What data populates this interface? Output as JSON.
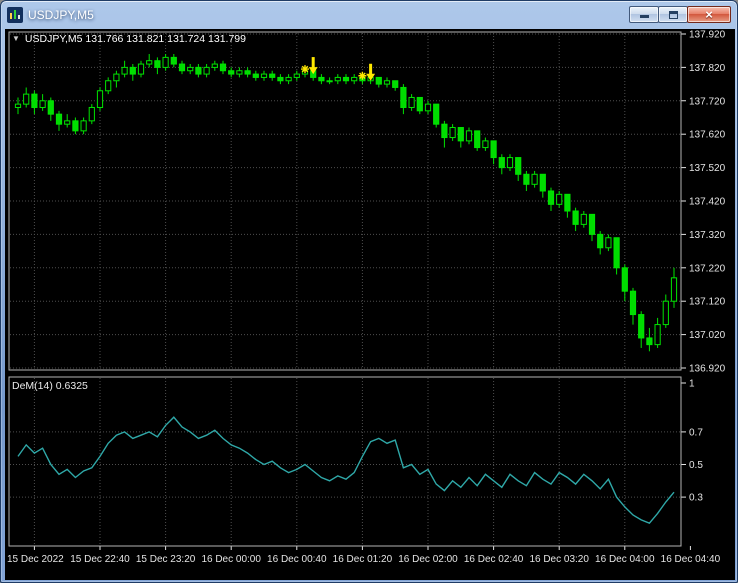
{
  "window": {
    "title": "USDJPY,M5"
  },
  "icons": {
    "collapse_arrow": "▼",
    "close_glyph": "×"
  },
  "chart": {
    "ohlc_text": "USDJPY,M5 131.766 131.821 131.724 131.799"
  },
  "chart_data": {
    "type": "candlestick",
    "symbol": "USDJPY",
    "timeframe": "M5",
    "main": {
      "price_max": 137.92,
      "price_min": 136.92,
      "price_axis": [
        "137.920",
        "137.820",
        "137.720",
        "137.620",
        "137.520",
        "137.420",
        "137.320",
        "137.220",
        "137.120",
        "137.020",
        "136.920"
      ],
      "candles": [
        [
          137.7,
          137.73,
          137.68,
          137.71
        ],
        [
          137.71,
          137.76,
          137.7,
          137.74
        ],
        [
          137.74,
          137.75,
          137.68,
          137.7
        ],
        [
          137.7,
          137.74,
          137.69,
          137.72
        ],
        [
          137.72,
          137.73,
          137.66,
          137.68
        ],
        [
          137.68,
          137.69,
          137.63,
          137.65
        ],
        [
          137.65,
          137.68,
          137.64,
          137.66
        ],
        [
          137.66,
          137.67,
          137.62,
          137.63
        ],
        [
          137.63,
          137.67,
          137.62,
          137.66
        ],
        [
          137.66,
          137.71,
          137.65,
          137.7
        ],
        [
          137.7,
          137.76,
          137.69,
          137.75
        ],
        [
          137.75,
          137.79,
          137.74,
          137.78
        ],
        [
          137.78,
          137.81,
          137.76,
          137.8
        ],
        [
          137.8,
          137.84,
          137.79,
          137.82
        ],
        [
          137.82,
          137.83,
          137.78,
          137.8
        ],
        [
          137.8,
          137.84,
          137.79,
          137.83
        ],
        [
          137.83,
          137.86,
          137.82,
          137.84
        ],
        [
          137.84,
          137.85,
          137.8,
          137.82
        ],
        [
          137.82,
          137.86,
          137.81,
          137.85
        ],
        [
          137.85,
          137.86,
          137.82,
          137.83
        ],
        [
          137.83,
          137.84,
          137.8,
          137.81
        ],
        [
          137.81,
          137.83,
          137.8,
          137.82
        ],
        [
          137.82,
          137.83,
          137.79,
          137.8
        ],
        [
          137.8,
          137.83,
          137.79,
          137.82
        ],
        [
          137.82,
          137.84,
          137.81,
          137.83
        ],
        [
          137.83,
          137.84,
          137.8,
          137.81
        ],
        [
          137.81,
          137.82,
          137.79,
          137.8
        ],
        [
          137.8,
          137.82,
          137.79,
          137.81
        ],
        [
          137.81,
          137.82,
          137.79,
          137.8
        ],
        [
          137.8,
          137.81,
          137.78,
          137.79
        ],
        [
          137.79,
          137.81,
          137.78,
          137.8
        ],
        [
          137.8,
          137.81,
          137.78,
          137.79
        ],
        [
          137.79,
          137.8,
          137.77,
          137.78
        ],
        [
          137.78,
          137.8,
          137.77,
          137.79
        ],
        [
          137.79,
          137.81,
          137.78,
          137.8
        ],
        [
          137.8,
          137.82,
          137.79,
          137.81
        ],
        [
          137.81,
          137.82,
          137.78,
          137.79
        ],
        [
          137.79,
          137.8,
          137.77,
          137.78
        ],
        [
          137.78,
          137.79,
          137.77,
          137.78
        ],
        [
          137.78,
          137.8,
          137.77,
          137.79
        ],
        [
          137.79,
          137.8,
          137.77,
          137.78
        ],
        [
          137.78,
          137.8,
          137.77,
          137.79
        ],
        [
          137.79,
          137.8,
          137.77,
          137.78
        ],
        [
          137.78,
          137.8,
          137.77,
          137.79
        ],
        [
          137.79,
          137.79,
          137.76,
          137.77
        ],
        [
          137.77,
          137.79,
          137.76,
          137.78
        ],
        [
          137.78,
          137.78,
          137.75,
          137.76
        ],
        [
          137.76,
          137.77,
          137.68,
          137.7
        ],
        [
          137.7,
          137.74,
          137.69,
          137.73
        ],
        [
          137.73,
          137.73,
          137.68,
          137.69
        ],
        [
          137.69,
          137.72,
          137.68,
          137.71
        ],
        [
          137.71,
          137.71,
          137.64,
          137.65
        ],
        [
          137.65,
          137.66,
          137.58,
          137.61
        ],
        [
          137.61,
          137.65,
          137.6,
          137.64
        ],
        [
          137.64,
          137.64,
          137.58,
          137.6
        ],
        [
          137.6,
          137.64,
          137.59,
          137.63
        ],
        [
          137.63,
          137.63,
          137.57,
          137.58
        ],
        [
          137.58,
          137.61,
          137.57,
          137.6
        ],
        [
          137.6,
          137.6,
          137.53,
          137.55
        ],
        [
          137.55,
          137.56,
          137.5,
          137.52
        ],
        [
          137.52,
          137.56,
          137.51,
          137.55
        ],
        [
          137.55,
          137.55,
          137.48,
          137.5
        ],
        [
          137.5,
          137.51,
          137.45,
          137.47
        ],
        [
          137.47,
          137.51,
          137.46,
          137.5
        ],
        [
          137.5,
          137.5,
          137.43,
          137.45
        ],
        [
          137.45,
          137.46,
          137.39,
          137.41
        ],
        [
          137.41,
          137.45,
          137.4,
          137.44
        ],
        [
          137.44,
          137.44,
          137.37,
          137.39
        ],
        [
          137.39,
          137.4,
          137.33,
          137.35
        ],
        [
          137.35,
          137.39,
          137.34,
          137.38
        ],
        [
          137.38,
          137.38,
          137.3,
          137.32
        ],
        [
          137.32,
          137.33,
          137.26,
          137.28
        ],
        [
          137.28,
          137.32,
          137.27,
          137.31
        ],
        [
          137.31,
          137.31,
          137.2,
          137.22
        ],
        [
          137.22,
          137.23,
          137.12,
          137.15
        ],
        [
          137.15,
          137.16,
          137.05,
          137.08
        ],
        [
          137.08,
          137.09,
          136.98,
          137.01
        ],
        [
          137.01,
          137.04,
          136.97,
          136.99
        ],
        [
          136.99,
          137.07,
          136.98,
          137.05
        ],
        [
          137.05,
          137.14,
          137.04,
          137.12
        ],
        [
          137.12,
          137.22,
          137.1,
          137.19
        ]
      ],
      "markers": [
        {
          "type": "asterisk",
          "candle": 35,
          "price": 137.815
        },
        {
          "type": "arrow-down",
          "candle": 36,
          "price": 137.8
        },
        {
          "type": "asterisk",
          "candle": 42,
          "price": 137.795
        },
        {
          "type": "arrow-down",
          "candle": 43,
          "price": 137.78
        }
      ]
    },
    "indicator": {
      "name": "DeMarker",
      "label": "DeM(14) 0.6325",
      "range": [
        0,
        1
      ],
      "axis": [
        {
          "label": "1",
          "value": 1
        },
        {
          "label": "0.7",
          "value": 0.7
        },
        {
          "label": "0.5",
          "value": 0.5
        },
        {
          "label": "0.3",
          "value": 0.3
        }
      ],
      "levels": [
        0.7,
        0.5,
        0.3
      ],
      "values": [
        0.55,
        0.62,
        0.57,
        0.6,
        0.5,
        0.44,
        0.47,
        0.42,
        0.46,
        0.48,
        0.55,
        0.63,
        0.68,
        0.7,
        0.66,
        0.68,
        0.7,
        0.67,
        0.74,
        0.79,
        0.73,
        0.7,
        0.66,
        0.68,
        0.71,
        0.66,
        0.62,
        0.6,
        0.57,
        0.53,
        0.5,
        0.52,
        0.48,
        0.45,
        0.47,
        0.5,
        0.46,
        0.42,
        0.4,
        0.43,
        0.41,
        0.45,
        0.55,
        0.64,
        0.66,
        0.63,
        0.65,
        0.48,
        0.5,
        0.44,
        0.47,
        0.38,
        0.34,
        0.4,
        0.36,
        0.42,
        0.37,
        0.44,
        0.4,
        0.36,
        0.44,
        0.4,
        0.37,
        0.45,
        0.41,
        0.38,
        0.45,
        0.42,
        0.38,
        0.44,
        0.4,
        0.35,
        0.41,
        0.3,
        0.24,
        0.19,
        0.16,
        0.14,
        0.2,
        0.27,
        0.33
      ]
    },
    "time_axis": {
      "labels": [
        "15 Dec 2022",
        "15 Dec 22:40",
        "15 Dec 23:20",
        "16 Dec 00:00",
        "16 Dec 00:40",
        "16 Dec 01:20",
        "16 Dec 02:00",
        "16 Dec 02:40",
        "16 Dec 03:20",
        "16 Dec 04:00",
        "16 Dec 04:40"
      ],
      "grid_candles": [
        2,
        10,
        18,
        26,
        34,
        42,
        50,
        58,
        66,
        74,
        82
      ]
    },
    "colors": {
      "background": "#000000",
      "grid": "#4e4e4e",
      "candle": "#00E400",
      "bull_fill": "#000000",
      "bear_fill": "#00DD00",
      "indicator_line": "#2FA8A8",
      "marker": "#FFE800",
      "axis_text": "#E4E4E4",
      "pane_border": "#B4B4B4"
    }
  }
}
